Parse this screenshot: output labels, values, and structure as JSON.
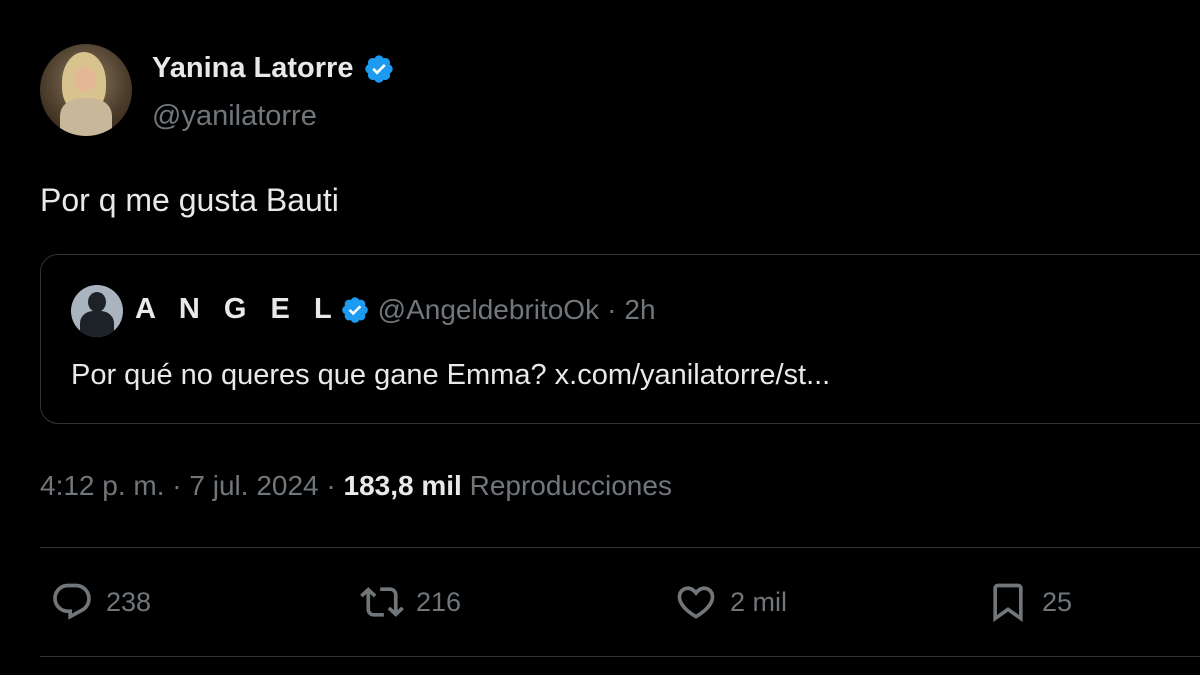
{
  "author": {
    "display_name": "Yanina Latorre",
    "handle": "@yanilatorre",
    "verified": true
  },
  "tweet": {
    "text": "Por q me gusta Bauti"
  },
  "quoted_tweet": {
    "display_name": "A N G E L",
    "handle": "@AngeldebritoOk",
    "separator": "·",
    "time": "2h",
    "text": "Por qué no queres que gane Emma? x.com/yanilatorre/st..."
  },
  "meta": {
    "time": "4:12 p. m.",
    "separator1": "·",
    "date": "7 jul. 2024",
    "separator2": "·",
    "views_count": "183,8 mil",
    "views_label": "Reproducciones"
  },
  "actions": {
    "replies": "238",
    "reposts": "216",
    "likes": "2 mil",
    "bookmarks": "25"
  },
  "colors": {
    "background": "#000000",
    "primary_text": "#e7e9ea",
    "secondary_text": "#71767b",
    "verified_blue": "#1d9bf0",
    "border": "#2f3336"
  },
  "icons": {
    "reply": "reply-icon",
    "repost": "repost-icon",
    "like": "heart-icon",
    "bookmark": "bookmark-icon",
    "verified": "verified-badge-icon"
  }
}
